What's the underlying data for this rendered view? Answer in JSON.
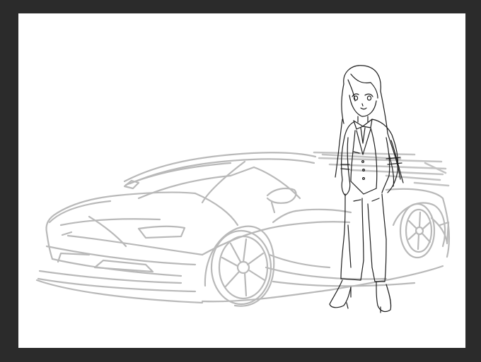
{
  "app": {
    "workspace_color": "#2b2b2b",
    "canvas_color": "#ffffff"
  },
  "canvas": {
    "layers": [
      {
        "name": "car-sketch",
        "stroke_color": "#b9b9b9",
        "description_icon": "sports-car-sketch"
      },
      {
        "name": "character-lineart",
        "stroke_color": "#1e1e1e",
        "description_icon": "standing-woman-lineart"
      }
    ]
  }
}
